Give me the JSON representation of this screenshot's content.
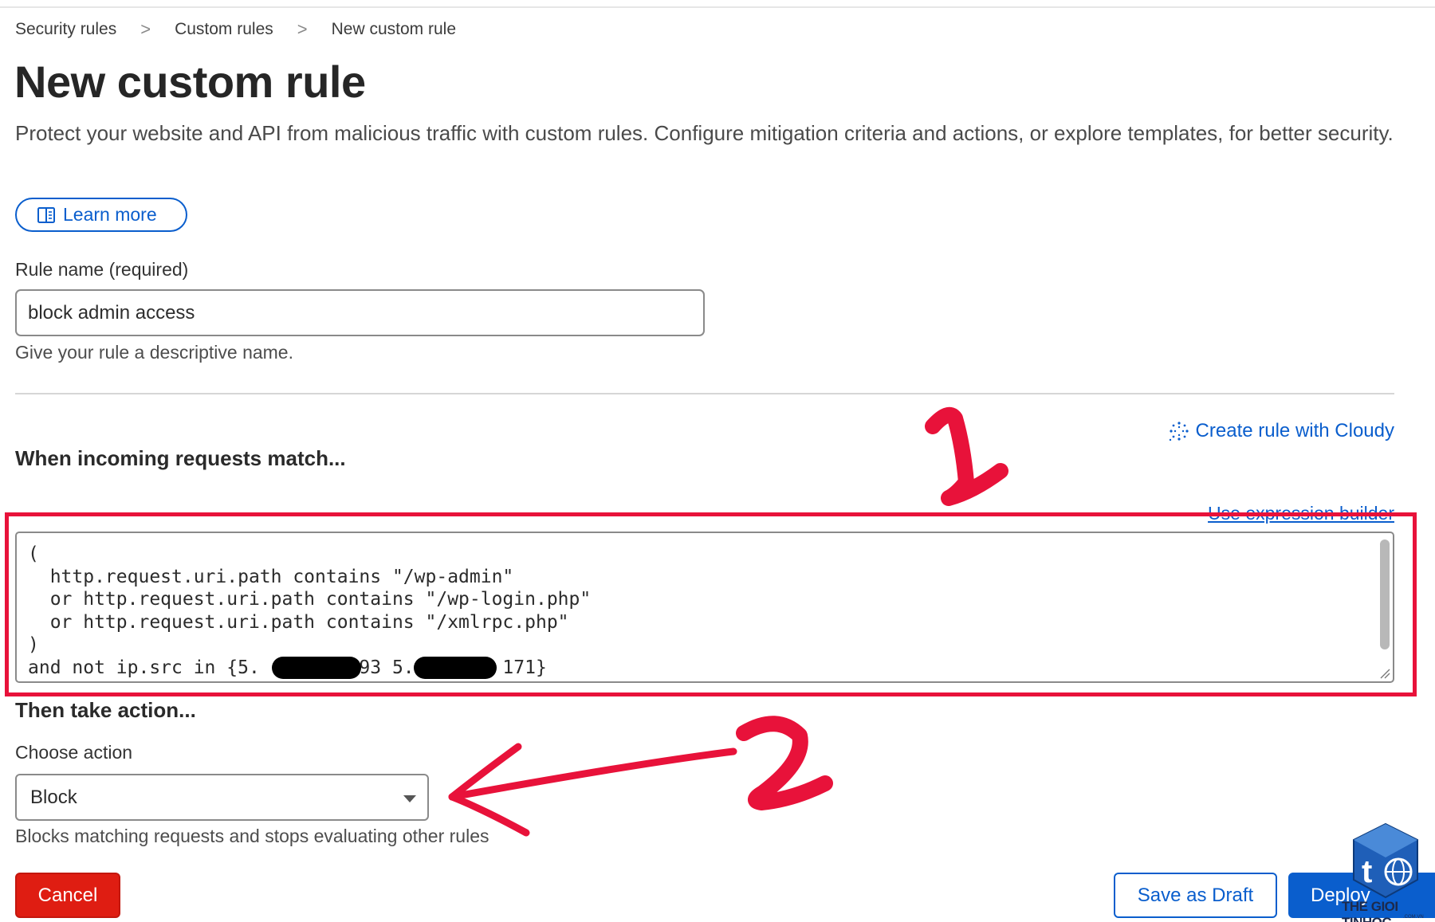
{
  "breadcrumb": {
    "items": [
      "Security rules",
      "Custom rules",
      "New custom rule"
    ],
    "separator": ">"
  },
  "page": {
    "title": "New custom rule",
    "description": "Protect your website and API from malicious traffic with custom rules. Configure mitigation criteria and actions, or explore templates, for better security.",
    "learn_more_label": "Learn more"
  },
  "rule_name": {
    "label": "Rule name (required)",
    "value": "block admin access",
    "help": "Give your rule a descriptive name."
  },
  "match": {
    "heading": "When incoming requests match...",
    "cloudy_label": "Create rule with Cloudy",
    "expression_builder_label": "Use expression builder",
    "expression_lines": [
      "(",
      "  http.request.uri.path contains \"/wp-admin\"",
      "  or http.request.uri.path contains \"/wp-login.php\"",
      "  or http.request.uri.path contains \"/xmlrpc.php\"",
      ")",
      "and not ip.src in {5.        .93 5.        171}"
    ]
  },
  "action": {
    "heading": "Then take action...",
    "label": "Choose action",
    "selected": "Block",
    "help": "Blocks matching requests and stops evaluating other rules"
  },
  "footer": {
    "cancel_label": "Cancel",
    "save_draft_label": "Save as Draft",
    "deploy_label": "Deploy"
  },
  "annotations": {
    "marker_1": "1",
    "marker_2": "2",
    "color": "#e8123a"
  },
  "watermark": {
    "brand": "THE GIOI TINHOC",
    "domain": ".COM.VN"
  },
  "colors": {
    "accent": "#0a5ecd",
    "danger": "#df1d12"
  }
}
